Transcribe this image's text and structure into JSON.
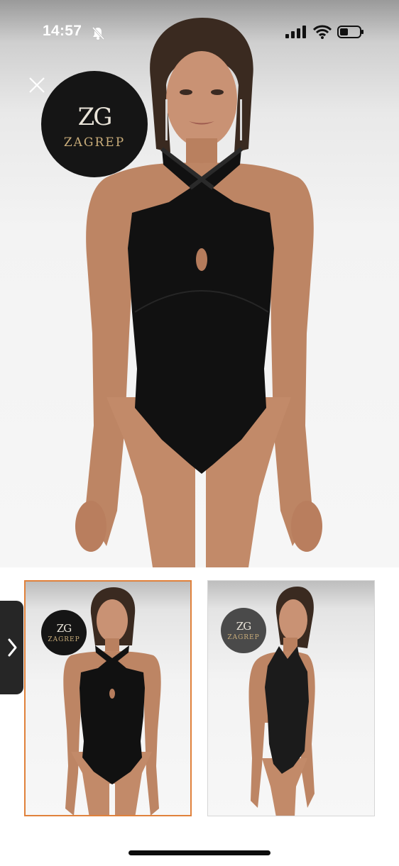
{
  "status_bar": {
    "time": "14:57",
    "icons": [
      "bell-slash-icon",
      "cellular-signal-icon",
      "wifi-icon",
      "battery-icon"
    ]
  },
  "viewer": {
    "close_icon": "close-icon",
    "brand": {
      "monogram": "ZG",
      "wordmark": "ZAGREP"
    },
    "selected_thumbnail": 1,
    "accent_color": "#e0813b"
  },
  "thumbnails": [
    {
      "brand_monogram": "ZG",
      "brand_wordmark": "ZAGREP",
      "view": "front"
    },
    {
      "brand_monogram": "ZG",
      "brand_wordmark": "ZAGREP",
      "view": "side"
    }
  ],
  "side_handle": {
    "icon": "chevron-right-icon"
  }
}
